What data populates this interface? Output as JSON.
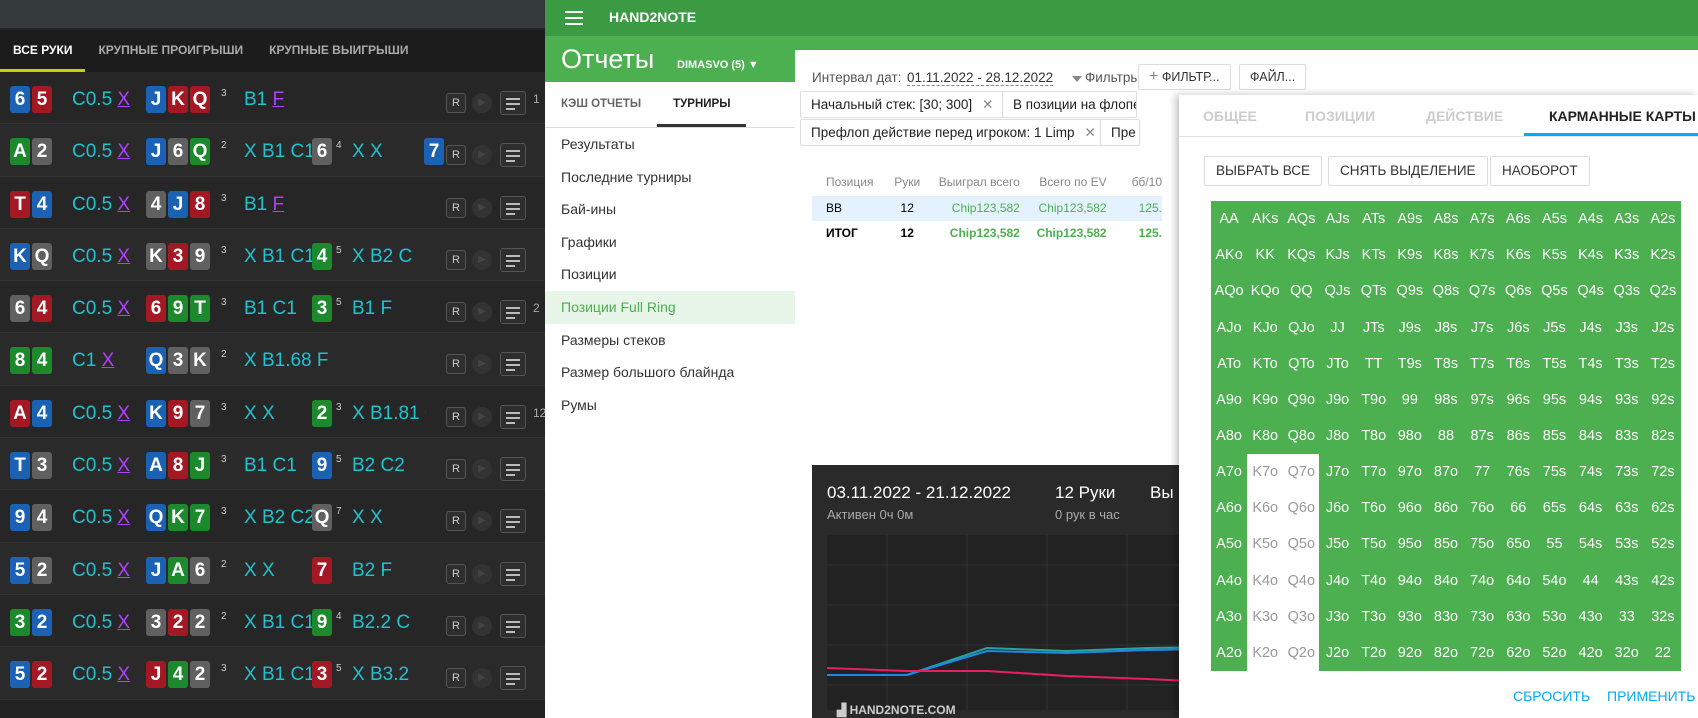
{
  "left_panel": {
    "tabs": [
      "ВСЕ РУКИ",
      "КРУПНЫЕ ПРОИГРЫШИ",
      "КРУПНЫЕ ВЫИГРЫШИ"
    ],
    "r_label": "R",
    "rows": [
      {
        "hole": [
          [
            "6",
            "b"
          ],
          [
            "5",
            "r"
          ]
        ],
        "pre": "C0.5",
        "board": [
          [
            "J",
            "b"
          ],
          [
            "K",
            "r"
          ],
          [
            "Q",
            "r"
          ]
        ],
        "sup": "3",
        "flop": "B1",
        "flop_act": "F",
        "turn": null,
        "river": null,
        "num": "1"
      },
      {
        "hole": [
          [
            "A",
            "g"
          ],
          [
            "2",
            "k"
          ]
        ],
        "pre": "C0.5",
        "board": [
          [
            "J",
            "b"
          ],
          [
            "6",
            "k"
          ],
          [
            "Q",
            "g"
          ]
        ],
        "sup": "2",
        "flop": "X B1 C1",
        "turn": [
          "6",
          "k",
          "4"
        ],
        "turn_act": "X X",
        "river": [
          "7",
          "b"
        ]
      },
      {
        "hole": [
          [
            "T",
            "r"
          ],
          [
            "4",
            "b"
          ]
        ],
        "pre": "C0.5",
        "board": [
          [
            "4",
            "k"
          ],
          [
            "J",
            "b"
          ],
          [
            "8",
            "r"
          ]
        ],
        "sup": "3",
        "flop": "B1",
        "flop_act": "F"
      },
      {
        "hole": [
          [
            "K",
            "b"
          ],
          [
            "Q",
            "k"
          ]
        ],
        "pre": "C0.5",
        "board": [
          [
            "K",
            "k"
          ],
          [
            "3",
            "r"
          ],
          [
            "9",
            "k"
          ]
        ],
        "sup": "3",
        "flop": "X B1 C1",
        "turn": [
          "4",
          "g",
          "5"
        ],
        "turn_act": "X B2 C"
      },
      {
        "hole": [
          [
            "6",
            "k"
          ],
          [
            "4",
            "r"
          ]
        ],
        "pre": "C0.5",
        "board": [
          [
            "6",
            "r"
          ],
          [
            "9",
            "g"
          ],
          [
            "T",
            "g"
          ]
        ],
        "sup": "3",
        "flop": "B1 C1",
        "turn": [
          "3",
          "g",
          "5"
        ],
        "turn_act": "B1 F",
        "num": "2"
      },
      {
        "hole": [
          [
            "8",
            "g"
          ],
          [
            "4",
            "g"
          ]
        ],
        "pre": "C1",
        "board": [
          [
            "Q",
            "b"
          ],
          [
            "3",
            "k"
          ],
          [
            "K",
            "k"
          ]
        ],
        "sup": "2",
        "flop": "X B1.68 F"
      },
      {
        "hole": [
          [
            "A",
            "r"
          ],
          [
            "4",
            "b"
          ]
        ],
        "pre": "C0.5",
        "board": [
          [
            "K",
            "b"
          ],
          [
            "9",
            "r"
          ],
          [
            "7",
            "k"
          ]
        ],
        "sup": "3",
        "flop": "X X",
        "turn": [
          "2",
          "g",
          "3"
        ],
        "turn_act": "X B1.81 C",
        "num": "12"
      },
      {
        "hole": [
          [
            "T",
            "b"
          ],
          [
            "3",
            "k"
          ]
        ],
        "pre": "C0.5",
        "board": [
          [
            "A",
            "b"
          ],
          [
            "8",
            "r"
          ],
          [
            "J",
            "g"
          ]
        ],
        "sup": "3",
        "flop": "B1 C1",
        "turn": [
          "9",
          "b",
          "5"
        ],
        "turn_act": "B2 C2"
      },
      {
        "hole": [
          [
            "9",
            "b"
          ],
          [
            "4",
            "k"
          ]
        ],
        "pre": "C0.5",
        "board": [
          [
            "Q",
            "b"
          ],
          [
            "K",
            "g"
          ],
          [
            "7",
            "g"
          ]
        ],
        "sup": "3",
        "flop": "X B2 C2",
        "turn": [
          "Q",
          "k",
          "7"
        ],
        "turn_act": "X X"
      },
      {
        "hole": [
          [
            "5",
            "b"
          ],
          [
            "2",
            "k"
          ]
        ],
        "pre": "C0.5",
        "board": [
          [
            "J",
            "b"
          ],
          [
            "A",
            "g"
          ],
          [
            "6",
            "k"
          ]
        ],
        "sup": "2",
        "flop": "X X",
        "turn": [
          "7",
          "r",
          ""
        ],
        "turn_act": "B2 F"
      },
      {
        "hole": [
          [
            "3",
            "g"
          ],
          [
            "2",
            "b"
          ]
        ],
        "pre": "C0.5",
        "board": [
          [
            "3",
            "k"
          ],
          [
            "2",
            "r"
          ],
          [
            "2",
            "k"
          ]
        ],
        "sup": "2",
        "flop": "X B1 C1",
        "turn": [
          "9",
          "g",
          "4"
        ],
        "turn_act": "B2.2 C"
      },
      {
        "hole": [
          [
            "5",
            "b"
          ],
          [
            "2",
            "r"
          ]
        ],
        "pre": "C0.5",
        "board": [
          [
            "J",
            "r"
          ],
          [
            "4",
            "g"
          ],
          [
            "2",
            "k"
          ]
        ],
        "sup": "3",
        "flop": "X B1 C1",
        "turn": [
          "3",
          "r",
          "5"
        ],
        "turn_act": "X B3.2"
      }
    ]
  },
  "app": {
    "title": "HAND2NOTE",
    "report_title": "Отчеты",
    "player": "DIMASVO (5)"
  },
  "sidebar": {
    "tabs": [
      "КЭШ ОТЧЕТЫ",
      "ТУРНИРЫ"
    ],
    "items": [
      "Результаты",
      "Последние турниры",
      "Бай-ины",
      "Графики",
      "Позиции",
      "Позиции Full Ring",
      "Размеры стеков",
      "Размер большого блайнда",
      "Румы"
    ]
  },
  "content": {
    "interval_label": "Интервал дат:",
    "interval_value": "01.11.2022 - 28.12.2022",
    "filters_label": "Фильтры:",
    "filter_btn": "ФИЛЬТР...",
    "file_btn": "ФАЙЛ...",
    "chips": [
      "Начальный стек: [30; 300]",
      "В позиции на флопе",
      "Префлоп действие перед игроком: 1 Limp",
      "Пре"
    ],
    "stats": {
      "headers": [
        "Позиция",
        "Руки",
        "Выиграл всего",
        "Всего по EV",
        "бб/10"
      ],
      "rows": [
        [
          "BB",
          "12",
          "Chip123,582",
          "Chip123,582",
          "125."
        ],
        [
          "ИТОГ",
          "12",
          "Chip123,582",
          "Chip123,582",
          "125."
        ]
      ]
    },
    "summary": {
      "dates": "03.11.2022 - 21.12.2022",
      "active": "Активен 0ч 0м",
      "hands": "12 Руки",
      "rate": "0 рук в час",
      "cut": "Вы",
      "logo": "HAND2NOTE.COM"
    }
  },
  "hole_cards": {
    "tabs": [
      "ОБЩЕЕ",
      "ПОЗИЦИИ",
      "ДЕЙСТВИЕ",
      "КАРМАННЫЕ КАРТЫ"
    ],
    "select_all": "ВЫБРАТЬ ВСЕ",
    "deselect": "СНЯТЬ ВЫДЕЛЕНИЕ",
    "invert": "НАОБОРОТ",
    "reset": "СБРОСИТЬ",
    "apply": "ПРИМЕНИТЬ",
    "unselected": [
      "K7o",
      "Q7o",
      "K6o",
      "Q6o",
      "K5o",
      "Q5o",
      "K4o",
      "Q4o",
      "K3o",
      "Q3o",
      "K2o",
      "Q2o"
    ],
    "ranks": [
      "A",
      "K",
      "Q",
      "J",
      "T",
      "9",
      "8",
      "7",
      "6",
      "5",
      "4",
      "3",
      "2"
    ]
  }
}
